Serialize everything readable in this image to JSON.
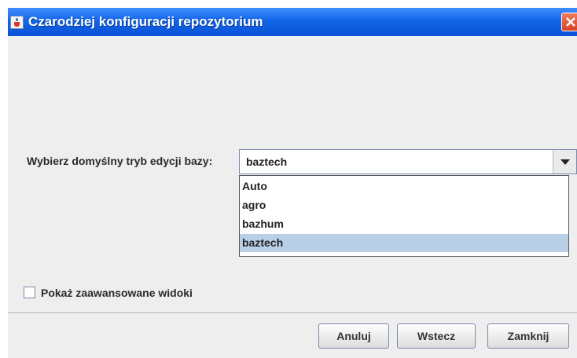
{
  "window": {
    "title": "Czarodziej konfiguracji repozytorium"
  },
  "icons": {
    "app": "java-cup-icon",
    "close": "close-icon",
    "dropdown_arrow": "chevron-down-icon"
  },
  "form": {
    "mode_label": "Wybierz domyślny tryb edycji bazy:",
    "mode_value": "baztech",
    "mode_options": [
      "Auto",
      "agro",
      "bazhum",
      "baztech"
    ],
    "advanced_views_label": "Pokaż zaawansowane widoki",
    "advanced_views_checked": false
  },
  "buttons": {
    "cancel": "Anuluj",
    "back": "Wstecz",
    "close": "Zamknij"
  },
  "colors": {
    "titlebar": "#1465e8",
    "selection": "#b8cfe5",
    "close_button": "#d84325"
  }
}
